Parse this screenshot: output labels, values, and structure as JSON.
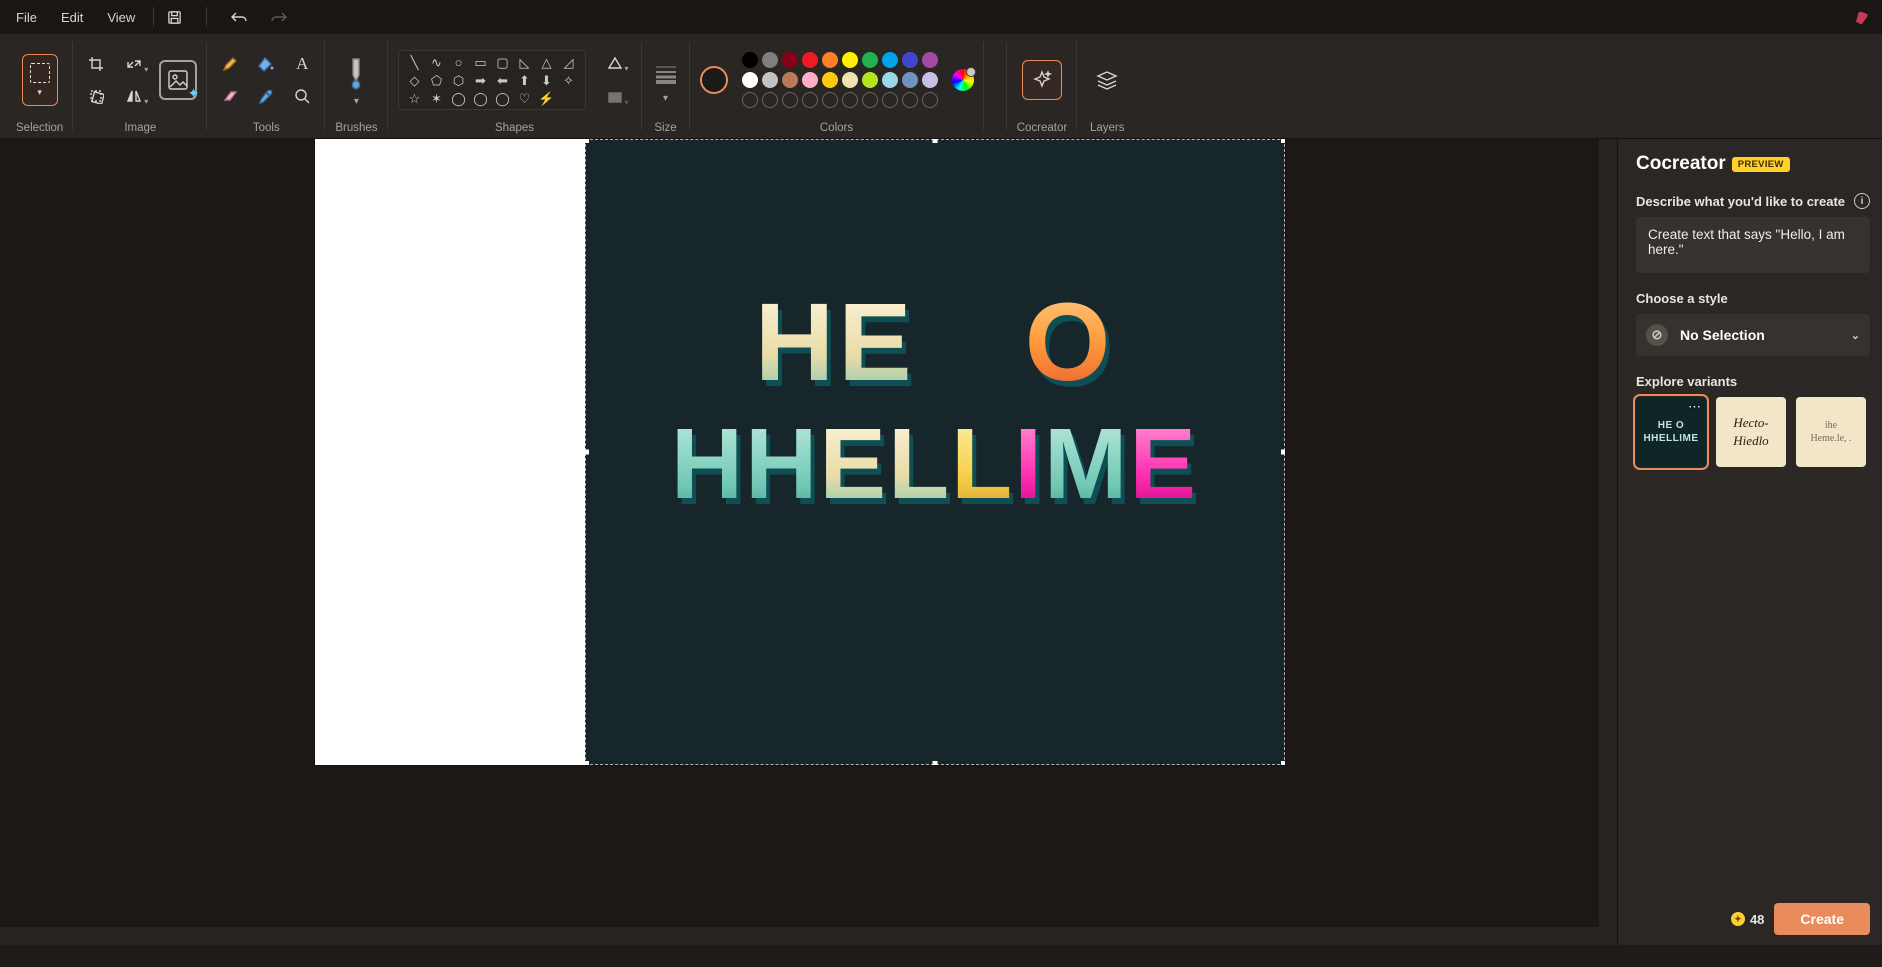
{
  "menubar": {
    "file": "File",
    "edit": "Edit",
    "view": "View"
  },
  "ribbon": {
    "selection": "Selection",
    "image": "Image",
    "tools": "Tools",
    "brushes": "Brushes",
    "shapes": "Shapes",
    "size": "Size",
    "colors": "Colors",
    "cocreator": "Cocreator",
    "layers": "Layers"
  },
  "colors": {
    "primary": "#1a1a1a",
    "row1": [
      "#000000",
      "#7f7f7f",
      "#880015",
      "#ed1c24",
      "#ff7f27",
      "#fff200",
      "#22b14c",
      "#00a2e8",
      "#3f48cc",
      "#a349a4"
    ],
    "row2": [
      "#ffffff",
      "#c3c3c3",
      "#b97a57",
      "#ffaec9",
      "#ffc90e",
      "#efe4b0",
      "#b5e61d",
      "#99d9ea",
      "#7092be",
      "#c8bfe7"
    ],
    "row3_outlines": 10
  },
  "cocreator": {
    "title": "Cocreator",
    "badge": "PREVIEW",
    "describe_label": "Describe what you'd like to create",
    "prompt_value": "Create text that says \"Hello, I am here.\"",
    "style_label": "Choose a style",
    "style_value": "No Selection",
    "variants_label": "Explore variants",
    "variant1_line1": "HE O",
    "variant1_line2": "HHELLIME",
    "variant2_line1": "Hecto-",
    "variant2_line2": "Hiedlo",
    "variant3_line1": "ihe",
    "variant3_line2": "Heme.le, .",
    "coins": "48",
    "create": "Create"
  },
  "canvas_art": {
    "line1": "HE  O",
    "line2": "HHELLIME"
  }
}
